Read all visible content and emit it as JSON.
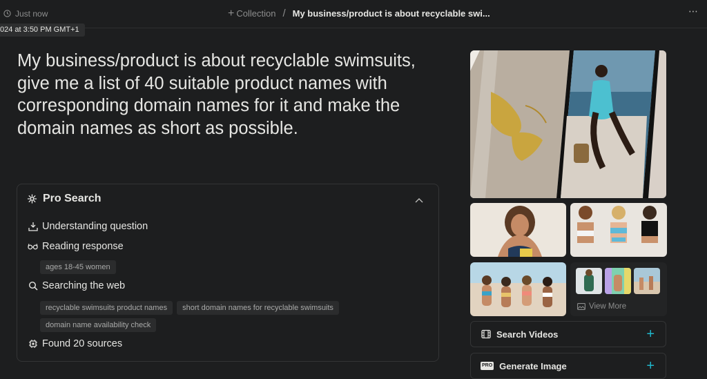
{
  "topbar": {
    "timestamp": "Just now",
    "collection": "Collection",
    "separator": "/",
    "thread_title": "My business/product is about recyclable swi...",
    "more": "⋯"
  },
  "tooltip": "024 at 3:50 PM GMT+1",
  "question": "My business/product is about recyclable swimsuits, give me a list of 40 suitable product names with corresponding domain names for it and make the domain names as short as possible.",
  "pro_search": {
    "title": "Pro Search",
    "steps": {
      "understanding": "Understanding question",
      "reading": "Reading response",
      "searching": "Searching the web",
      "found": "Found 20 sources"
    },
    "reading_chips": [
      "ages 18-45 women"
    ],
    "search_chips": [
      "recyclable swimsuits product names",
      "short domain names for recyclable swimsuits",
      "domain name availability check"
    ]
  },
  "side": {
    "view_more": "View More",
    "search_videos": "Search Videos",
    "generate_image": "Generate Image",
    "pro_badge": "PRO"
  },
  "colors": {
    "accent": "#20b8cd",
    "background": "#1d1e1f"
  }
}
